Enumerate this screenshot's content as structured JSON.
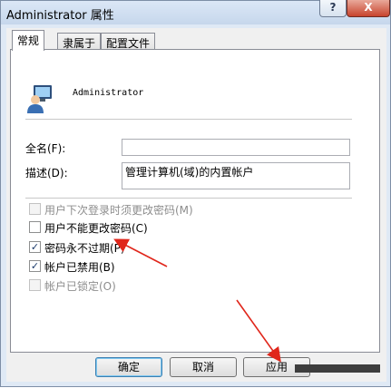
{
  "window": {
    "title": "Administrator 属性",
    "help_glyph": "?",
    "close_glyph": "X"
  },
  "tabs": [
    {
      "label": "常规"
    },
    {
      "label": "隶属于"
    },
    {
      "label": "配置文件"
    }
  ],
  "user": {
    "name": "Administrator",
    "icon": "user-icon"
  },
  "fields": {
    "fullname_label": "全名(F):",
    "fullname_value": "",
    "description_label": "描述(D):",
    "description_value": "管理计算机(域)的内置帐户"
  },
  "checkboxes": [
    {
      "label": "用户下次登录时须更改密码(M)",
      "checked": "",
      "enabled": false
    },
    {
      "label": "用户不能更改密码(C)",
      "checked": "",
      "enabled": true
    },
    {
      "label": "密码永不过期(P)",
      "checked": "✓",
      "enabled": true
    },
    {
      "label": "帐户已禁用(B)",
      "checked": "✓",
      "enabled": true
    },
    {
      "label": "帐户已锁定(O)",
      "checked": "",
      "enabled": false
    }
  ],
  "buttons": {
    "ok": "确定",
    "cancel": "取消",
    "apply": "应用"
  },
  "annotation": {
    "arrow_color": "#e0261b"
  }
}
